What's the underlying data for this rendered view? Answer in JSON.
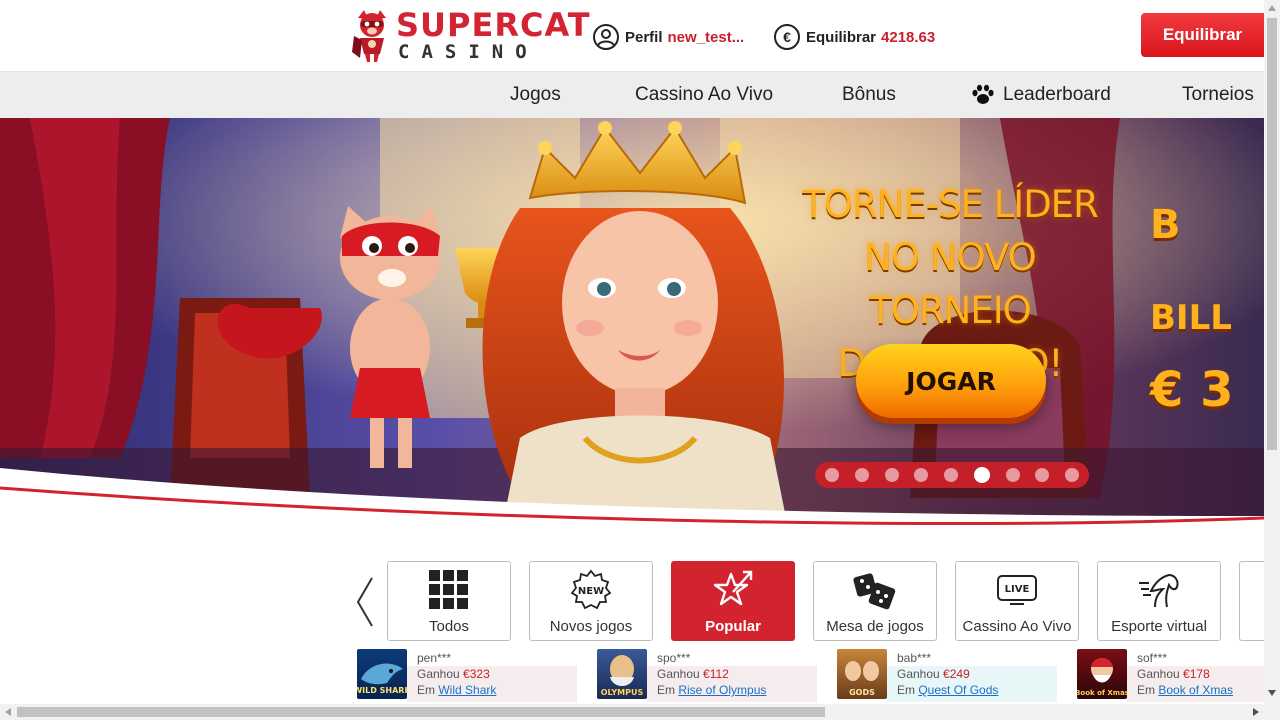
{
  "header": {
    "logo": {
      "line1": "SUPERCAT",
      "line2": "CASINO"
    },
    "profile": {
      "label": "Perfil",
      "value": "new_test..."
    },
    "balance": {
      "label": "Equilibrar",
      "value": "4218.63",
      "currency_icon": "€"
    },
    "deposit_button": "Equilibrar"
  },
  "nav": {
    "items": [
      {
        "label": "Jogos"
      },
      {
        "label": "Cassino Ao Vivo"
      },
      {
        "label": "Bônus"
      },
      {
        "label": "Leaderboard",
        "icon": "paw-icon"
      },
      {
        "label": "Torneios"
      }
    ]
  },
  "banner": {
    "headline": [
      "TORNE-SE LÍDER",
      "NO NOVO TORNEIO",
      "DA FUGASO!"
    ],
    "cta": "JOGAR",
    "slides_total": 9,
    "active_slide": 6,
    "next_slide_partial": {
      "line1": "B",
      "line2": "BILL",
      "line3": "€ 3"
    }
  },
  "categories": [
    {
      "label": "Todos",
      "icon": "grid-icon",
      "active": false
    },
    {
      "label": "Novos jogos",
      "icon": "new-badge-icon",
      "active": false
    },
    {
      "label": "Popular",
      "icon": "star-arrow-icon",
      "active": true
    },
    {
      "label": "Mesa de jogos",
      "icon": "dice-icon",
      "active": false
    },
    {
      "label": "Cassino Ao Vivo",
      "icon": "live-tv-icon",
      "active": false
    },
    {
      "label": "Esporte virtual",
      "icon": "horse-icon",
      "active": false
    }
  ],
  "winners": [
    {
      "user": "pen***",
      "won_label": "Ganhou",
      "amount": "€323",
      "in_label": "Em",
      "game": "Wild Shark",
      "thumb_text": "WILD SHARK"
    },
    {
      "user": "spo***",
      "won_label": "Ganhou",
      "amount": "€112",
      "in_label": "Em",
      "game": "Rise of Olympus",
      "thumb_text": "OLYMPUS"
    },
    {
      "user": "bab***",
      "won_label": "Ganhou",
      "amount": "€249",
      "in_label": "Em",
      "game": "Quest Of Gods",
      "thumb_text": "GODS"
    },
    {
      "user": "sof***",
      "won_label": "Ganhou",
      "amount": "€178",
      "in_label": "Em",
      "game": "Book of Xmas",
      "thumb_text": "Book of Xmas"
    }
  ],
  "colors": {
    "brand_red": "#d3232e",
    "accent_orange": "#ffb21c",
    "nav_bg": "#ededed"
  }
}
